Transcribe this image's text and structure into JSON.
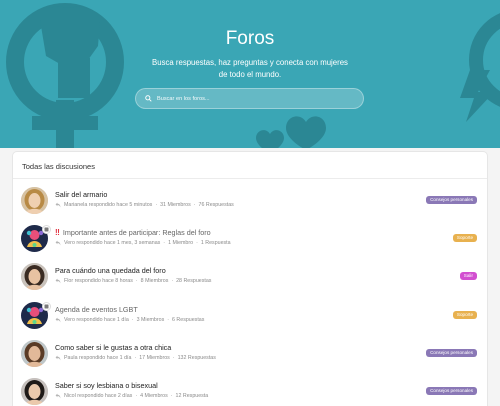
{
  "hero": {
    "title": "Foros",
    "subtitle": "Busca respuestas, haz preguntas y conecta con mujeres de todo el mundo.",
    "search_placeholder": "Buscar en los foros...",
    "bg_color": "#3aa6b5"
  },
  "card": {
    "title": "Todas las discusiones"
  },
  "threads": [
    {
      "title": "Salir del armario",
      "important": false,
      "meta": "Marianela respondido hace 5 minutos",
      "members": "31 Miembros",
      "replies": "76 Respuestas",
      "tag": "Consejos personales",
      "tag_color": "#8a78b6",
      "avatar": "woman-blonde",
      "muted": false
    },
    {
      "title": "Importante antes de participar: Reglas del foro",
      "important": true,
      "meta": "Vero respondido hace 1 mes, 3 semanas",
      "members": "1 Miembro",
      "replies": "1 Respuesta",
      "tag": "Soporte",
      "tag_color": "#e8b14f",
      "avatar": "colorful-logo",
      "muted": true
    },
    {
      "title": "Para cuándo una quedada del foro",
      "important": false,
      "meta": "Flor respondido hace 8 horas",
      "members": "8 Miembros",
      "replies": "28 Respuestas",
      "tag": "Salir",
      "tag_color": "#d24fd0",
      "avatar": "woman-smiling",
      "muted": false
    },
    {
      "title": "Agenda de eventos LGBT",
      "important": false,
      "meta": "Vero respondido hace 1 día",
      "members": "3 Miembros",
      "replies": "6 Respuestas",
      "tag": "Soporte",
      "tag_color": "#e8b14f",
      "avatar": "colorful-logo",
      "muted": true
    },
    {
      "title": "Como saber si le gustas a otra chica",
      "important": false,
      "meta": "Paula respondido hace 1 día",
      "members": "17 Miembros",
      "replies": "132 Respuestas",
      "tag": "Consejos personales",
      "tag_color": "#8a78b6",
      "avatar": "woman-short-hair",
      "muted": false
    },
    {
      "title": "Saber si soy lesbiana o bisexual",
      "important": false,
      "meta": "Nicol respondido hace 2 días",
      "members": "4 Miembros",
      "replies": "12 Respuesta",
      "tag": "Consejos personales",
      "tag_color": "#8a78b6",
      "avatar": "woman-dark-hair",
      "muted": false
    }
  ]
}
